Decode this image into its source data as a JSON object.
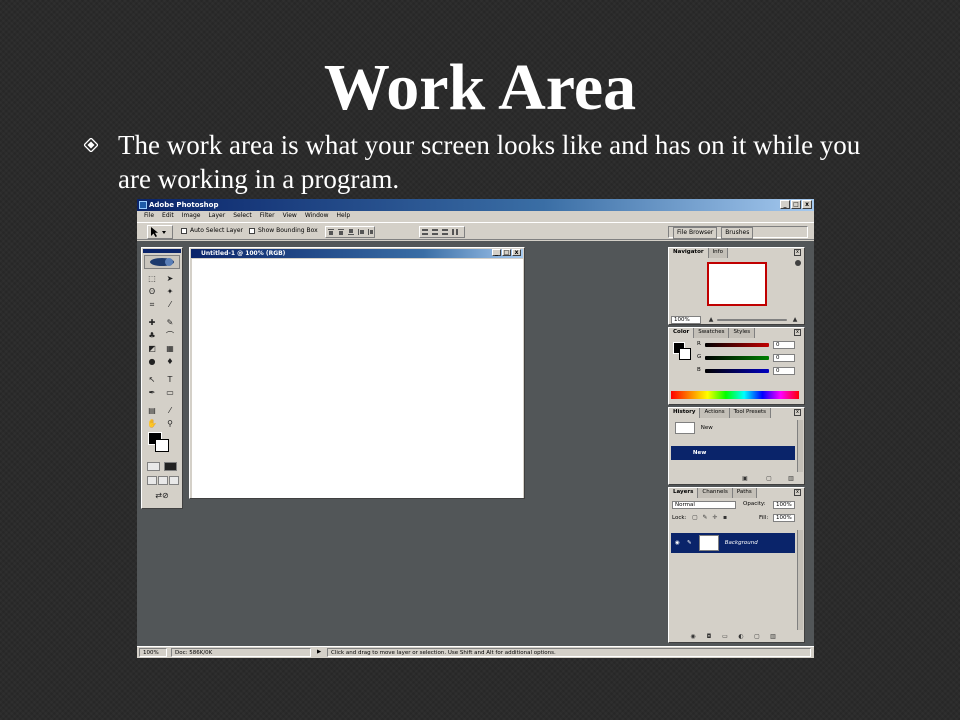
{
  "slide": {
    "title": "Work Area",
    "bullet": "The work area is what your screen looks like and has on it while you are working in a program."
  },
  "app": {
    "title": "Adobe Photoshop",
    "window_buttons": [
      "_",
      "□",
      "x"
    ],
    "menu": [
      "File",
      "Edit",
      "Image",
      "Layer",
      "Select",
      "Filter",
      "View",
      "Window",
      "Help"
    ],
    "options_bar": {
      "auto_select_label": "Auto Select Layer",
      "bounding_box_label": "Show Bounding Box",
      "well_tabs": [
        "File Browser",
        "Brushes"
      ]
    },
    "document": {
      "title": "Untitled-1 @ 100% (RGB)"
    },
    "status_bar": {
      "zoom": "100%",
      "doc": "Doc: 586K/0K",
      "hint": "Click and drag to move layer or selection.  Use Shift and Alt for additional options."
    },
    "navigator": {
      "tabs": [
        "Navigator",
        "Info"
      ],
      "zoom": "100%"
    },
    "color": {
      "tabs": [
        "Color",
        "Swatches",
        "Styles"
      ],
      "channels": [
        {
          "label": "R",
          "value": "0",
          "color": "#c00000"
        },
        {
          "label": "G",
          "value": "0",
          "color": "#008000"
        },
        {
          "label": "B",
          "value": "0",
          "color": "#0000c0"
        }
      ]
    },
    "history": {
      "tabs": [
        "History",
        "Actions",
        "Tool Presets"
      ],
      "snapshot_label": "New",
      "items": [
        "New"
      ]
    },
    "layers": {
      "tabs": [
        "Layers",
        "Channels",
        "Paths"
      ],
      "blend_mode": "Normal",
      "opacity_label": "Opacity:",
      "opacity": "100%",
      "lock_label": "Lock:",
      "fill_label": "Fill:",
      "fill": "100%",
      "layer_name": "Background"
    }
  }
}
